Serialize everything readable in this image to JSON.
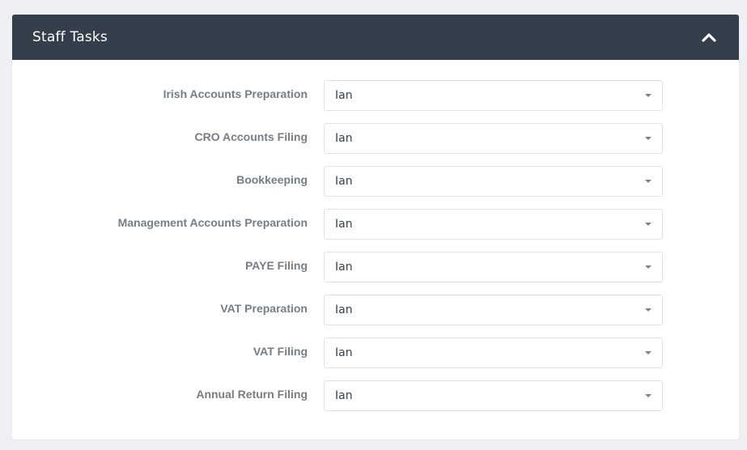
{
  "panel": {
    "title": "Staff Tasks",
    "collapse_icon": "chevron-up-icon"
  },
  "colors": {
    "header_bg": "#343f4b",
    "page_bg": "#eef0f3",
    "label": "#777d83"
  },
  "rows": [
    {
      "label": "Irish Accounts Preparation",
      "value": "Ian"
    },
    {
      "label": "CRO Accounts Filing",
      "value": "Ian"
    },
    {
      "label": "Bookkeeping",
      "value": "Ian"
    },
    {
      "label": "Management Accounts Preparation",
      "value": "Ian"
    },
    {
      "label": "PAYE Filing",
      "value": "Ian"
    },
    {
      "label": "VAT Preparation",
      "value": "Ian"
    },
    {
      "label": "VAT Filing",
      "value": "Ian"
    },
    {
      "label": "Annual Return Filing",
      "value": "Ian"
    }
  ]
}
